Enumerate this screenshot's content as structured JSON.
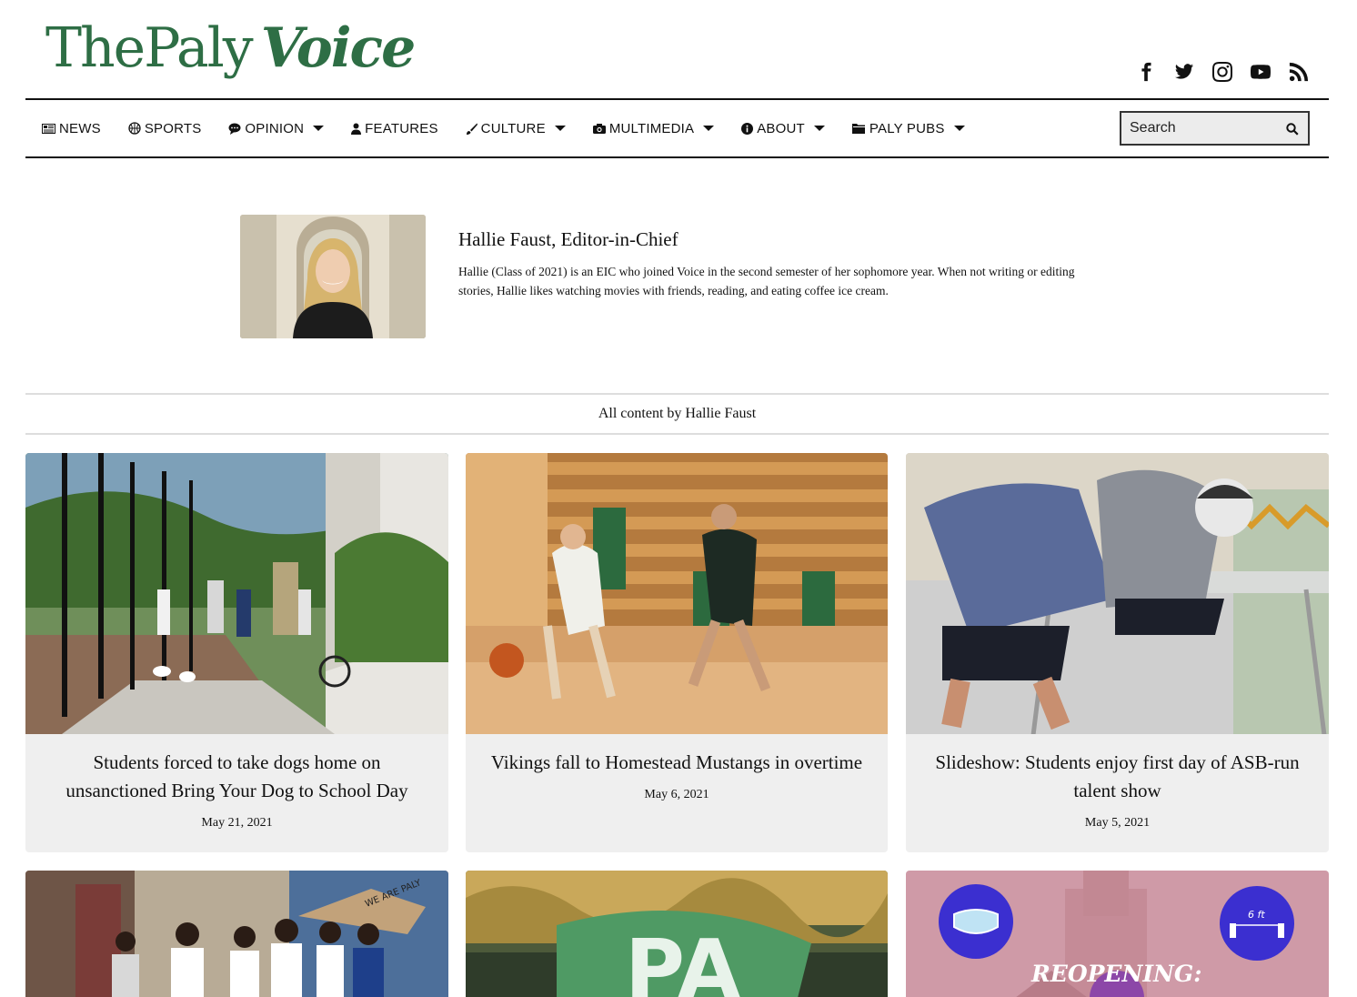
{
  "site": {
    "logo_part1": "ThePaly",
    "logo_part2": "Voice"
  },
  "social": [
    "facebook-icon",
    "twitter-icon",
    "instagram-icon",
    "youtube-icon",
    "rss-icon"
  ],
  "nav": {
    "items": [
      {
        "label": "NEWS",
        "icon": "newspaper-icon",
        "dropdown": false
      },
      {
        "label": "SPORTS",
        "icon": "basketball-icon",
        "dropdown": false
      },
      {
        "label": "OPINION",
        "icon": "comment-icon",
        "dropdown": true
      },
      {
        "label": "FEATURES",
        "icon": "user-icon",
        "dropdown": false
      },
      {
        "label": "CULTURE",
        "icon": "brush-icon",
        "dropdown": true
      },
      {
        "label": "MULTIMEDIA",
        "icon": "camera-icon",
        "dropdown": true
      },
      {
        "label": "ABOUT",
        "icon": "info-icon",
        "dropdown": true
      },
      {
        "label": "PALY PUBS",
        "icon": "folder-icon",
        "dropdown": true
      }
    ],
    "search_placeholder": "Search"
  },
  "profile": {
    "name": "Hallie Faust, Editor-in-Chief",
    "bio": "Hallie (Class of 2021) is an EIC who joined Voice in the second semester of her sophomore year. When not writing or editing stories, Hallie likes watching movies with friends, reading, and eating coffee ice cream."
  },
  "section_heading": "All content by Hallie Faust",
  "articles": [
    {
      "title": "Students forced to take dogs home on unsanctioned Bring Your Dog to School Day",
      "date": "May 21, 2021"
    },
    {
      "title": "Vikings fall to Homestead Mustangs in overtime",
      "date": "May 6, 2021"
    },
    {
      "title": "Slideshow: Students enjoy first day of ASB-run talent show",
      "date": "May 5, 2021"
    }
  ],
  "bottom_cards": {
    "mural_text": "WE ARE PALY",
    "flag_text": "PA",
    "reopening_text": "REOPENING:",
    "distance_text": "6 ft"
  },
  "colors": {
    "brand_green": "#2e6e45",
    "card_bg": "#efefef"
  }
}
